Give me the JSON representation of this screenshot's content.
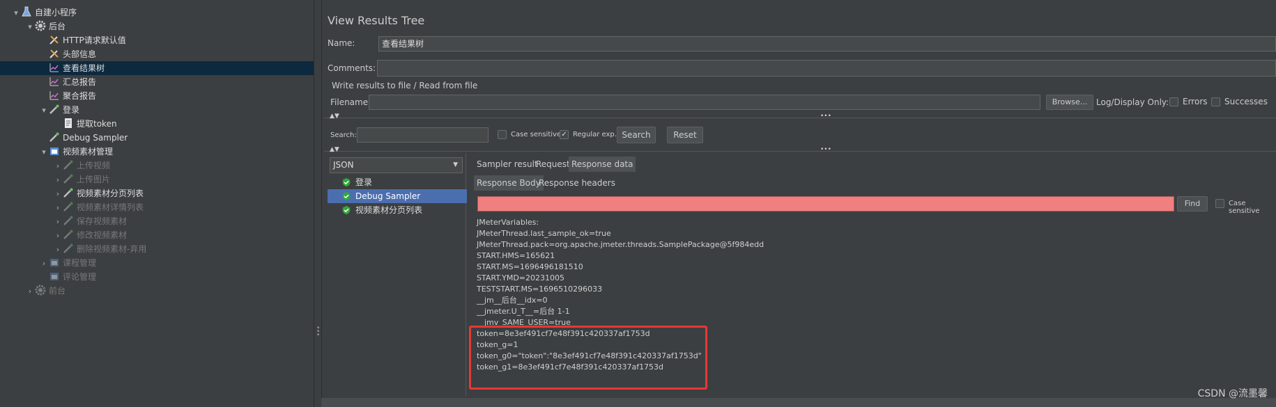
{
  "tree": {
    "items": [
      {
        "label": "自建小程序",
        "icon": "flask-icon",
        "toggle": "▾",
        "dim": false
      },
      {
        "label": "后台",
        "icon": "gear-icon",
        "toggle": "▾",
        "dim": false
      },
      {
        "label": "HTTP请求默认值",
        "icon": "wrench-icon",
        "toggle": "",
        "dim": false
      },
      {
        "label": "头部信息",
        "icon": "wrench-icon",
        "toggle": "",
        "dim": false
      },
      {
        "label": "查看结果树",
        "icon": "chart-icon",
        "toggle": "",
        "dim": false
      },
      {
        "label": "汇总报告",
        "icon": "chart-icon",
        "toggle": "",
        "dim": false
      },
      {
        "label": "聚合报告",
        "icon": "chart-icon",
        "toggle": "",
        "dim": false
      },
      {
        "label": "登录",
        "icon": "pipette-icon",
        "toggle": "▾",
        "dim": false
      },
      {
        "label": "提取token",
        "icon": "document-icon",
        "toggle": "",
        "dim": false
      },
      {
        "label": "Debug Sampler",
        "icon": "pipette-icon",
        "toggle": "",
        "dim": false
      },
      {
        "label": "视频素材管理",
        "icon": "folder-icon",
        "toggle": "▾",
        "dim": false
      },
      {
        "label": "上传视频",
        "icon": "pipette-icon",
        "toggle": "›",
        "dim": true
      },
      {
        "label": "上传图片",
        "icon": "pipette-icon",
        "toggle": "›",
        "dim": true
      },
      {
        "label": "视频素材分页列表",
        "icon": "pipette-icon",
        "toggle": "›",
        "dim": false
      },
      {
        "label": "视频素材详情列表",
        "icon": "pipette-icon",
        "toggle": "›",
        "dim": true
      },
      {
        "label": "保存视频素材",
        "icon": "pipette-icon",
        "toggle": "›",
        "dim": true
      },
      {
        "label": "修改视频素材",
        "icon": "pipette-icon",
        "toggle": "›",
        "dim": true
      },
      {
        "label": "删除视频素材-弃用",
        "icon": "pipette-icon",
        "toggle": "›",
        "dim": true
      },
      {
        "label": "课程管理",
        "icon": "folder-icon",
        "toggle": "›",
        "dim": true
      },
      {
        "label": "评论管理",
        "icon": "folder-icon",
        "toggle": "",
        "dim": true
      },
      {
        "label": "前台",
        "icon": "gear-icon",
        "toggle": "›",
        "dim": true
      }
    ],
    "selected_index": 4
  },
  "panel": {
    "title": "View Results Tree",
    "name_label": "Name:",
    "name_value": "查看结果树",
    "comments_label": "Comments:",
    "comments_value": "",
    "write_results_legend": "Write results to file / Read from file",
    "filename_label": "Filename",
    "filename_value": "",
    "browse_label": "Browse...",
    "logdisplay_label": "Log/Display Only:",
    "errors_label": "Errors",
    "successes_label": "Successes"
  },
  "search": {
    "label": "Search:",
    "value": "",
    "case_sensitive_label": "Case sensitive",
    "case_sensitive_checked": false,
    "regular_exp_label": "Regular exp.",
    "regular_exp_checked": true,
    "search_button": "Search",
    "reset_button": "Reset"
  },
  "renderer": {
    "selected": "JSON"
  },
  "samplers": [
    {
      "label": "登录",
      "status": "success"
    },
    {
      "label": "Debug Sampler",
      "status": "success"
    },
    {
      "label": "视频素材分页列表",
      "status": "success"
    }
  ],
  "selected_sampler_index": 1,
  "tabs": [
    "Sampler result",
    "Request",
    "Response data"
  ],
  "active_tab": "Response data",
  "subtabs": [
    "Response Body",
    "Response headers"
  ],
  "active_subtab": "Response Body",
  "find": {
    "value": "",
    "button": "Find",
    "case_sensitive_label": "Case sensitive",
    "field_color": "#f07f7f"
  },
  "response_lines": [
    "JMeterVariables:",
    "JMeterThread.last_sample_ok=true",
    "JMeterThread.pack=org.apache.jmeter.threads.SamplePackage@5f984edd",
    "START.HMS=165621",
    "START.MS=1696496181510",
    "START.YMD=20231005",
    "TESTSTART.MS=1696510296033",
    "__jm__后台__idx=0",
    "__jmeter.U_T__=后台 1-1",
    "__jmv_SAME_USER=true",
    "token=8e3ef491cf7e48f391c420337af1753d",
    "token_g=1",
    "token_g0=\"token\":\"8e3ef491cf7e48f391c420337af1753d\"",
    "token_g1=8e3ef491cf7e48f391c420337af1753d"
  ],
  "highlight_color": "#e53935",
  "watermark": "CSDN @流墨馨"
}
